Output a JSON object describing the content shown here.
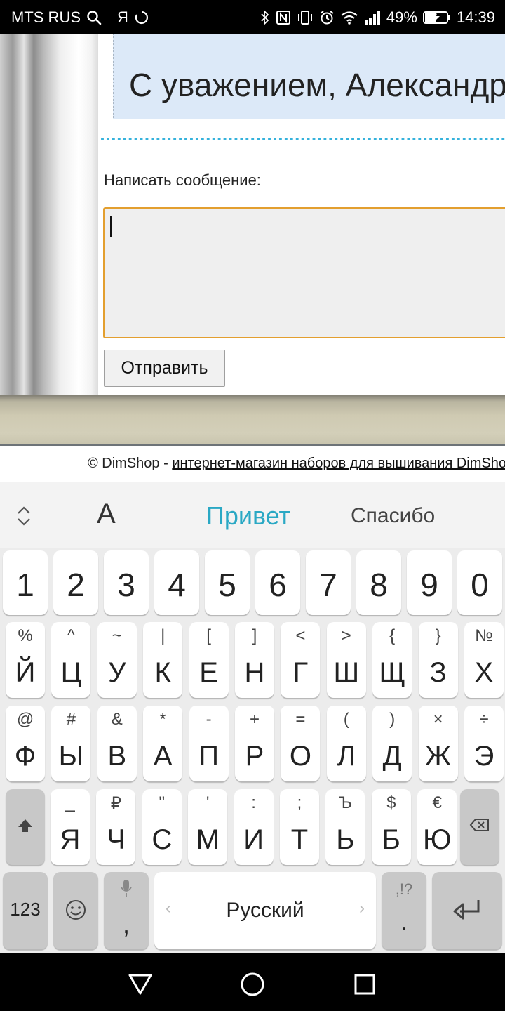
{
  "status_bar": {
    "carrier": "MTS RUS",
    "carrier_extra": "Я",
    "battery": "49%",
    "time": "14:39",
    "icons": [
      "search-icon",
      "sync-icon",
      "bluetooth-icon",
      "nfc-icon",
      "vibrate-icon",
      "alarm-icon",
      "wifi-icon",
      "signal-icon",
      "battery-icon"
    ]
  },
  "page": {
    "quote": "С уважением, Александр",
    "message_label": "Написать сообщение:",
    "message_value": "",
    "send_label": "Отправить",
    "footer_prefix": "© DimShop - ",
    "footer_link": "интернет-магазин наборов для вышивания DimShop"
  },
  "keyboard": {
    "suggestions": {
      "toggle_icon": "expand-collapse-icon",
      "font_label": "A",
      "primary": "Привет",
      "secondary": "Спасибо"
    },
    "numbers": [
      "1",
      "2",
      "3",
      "4",
      "5",
      "6",
      "7",
      "8",
      "9",
      "0"
    ],
    "row1": [
      {
        "main": "Й",
        "alt": "%"
      },
      {
        "main": "Ц",
        "alt": "^"
      },
      {
        "main": "У",
        "alt": "~"
      },
      {
        "main": "К",
        "alt": "|"
      },
      {
        "main": "Е",
        "alt": "["
      },
      {
        "main": "Н",
        "alt": "]"
      },
      {
        "main": "Г",
        "alt": "<"
      },
      {
        "main": "Ш",
        "alt": ">"
      },
      {
        "main": "Щ",
        "alt": "{"
      },
      {
        "main": "З",
        "alt": "}"
      },
      {
        "main": "Х",
        "alt": "№"
      }
    ],
    "row2": [
      {
        "main": "Ф",
        "alt": "@"
      },
      {
        "main": "Ы",
        "alt": "#"
      },
      {
        "main": "В",
        "alt": "&"
      },
      {
        "main": "А",
        "alt": "*"
      },
      {
        "main": "П",
        "alt": "-"
      },
      {
        "main": "Р",
        "alt": "+"
      },
      {
        "main": "О",
        "alt": "="
      },
      {
        "main": "Л",
        "alt": "("
      },
      {
        "main": "Д",
        "alt": ")"
      },
      {
        "main": "Ж",
        "alt": "×"
      },
      {
        "main": "Э",
        "alt": "÷"
      }
    ],
    "row3": [
      {
        "main": "Я",
        "alt": "_"
      },
      {
        "main": "Ч",
        "alt": "₽"
      },
      {
        "main": "С",
        "alt": "\""
      },
      {
        "main": "М",
        "alt": "'"
      },
      {
        "main": "И",
        "alt": ":"
      },
      {
        "main": "Т",
        "alt": ";"
      },
      {
        "main": "Ь",
        "alt": "Ъ"
      },
      {
        "main": "Б",
        "alt": "$"
      },
      {
        "main": "Ю",
        "alt": "€"
      }
    ],
    "bottom": {
      "symbols_label": "123",
      "comma_label": ",",
      "space_label": "Русский",
      "period_label": ".",
      "punct_alt": ",!?"
    }
  },
  "colors": {
    "accent_suggestion": "#2aa8c4",
    "textarea_border": "#e39f2f",
    "dotted_divider": "#35b2dc",
    "quote_background": "#dce9f8"
  }
}
